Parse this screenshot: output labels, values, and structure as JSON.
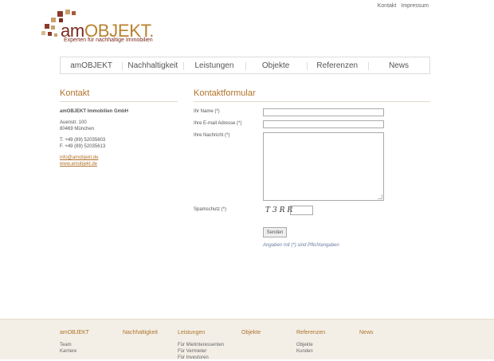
{
  "toplinks": [
    "Kontakt",
    "Impressum"
  ],
  "logo": {
    "am": "am",
    "objekt": "OBJEKT.",
    "tagline": "Experten für nachhaltige Immobilien"
  },
  "nav": [
    "amOBJEKT",
    "Nachhaltigkeit",
    "Leistungen",
    "Objekte",
    "Referenzen",
    "News"
  ],
  "kontakt": {
    "title": "Kontakt",
    "company": "amOBJEKT Immobilien GmbH",
    "street": "Auenstr. 100",
    "city": "80469 München",
    "phone": "T. +49 (89) 52035603",
    "fax": "F. +49 (89) 52035613",
    "email": "info@amobjekt.de",
    "web": "www.amobjekt.de"
  },
  "form": {
    "title": "Kontaktformular",
    "name_label": "Ihr Name (*)",
    "email_label": "Ihre E-mail Adresse (*)",
    "message_label": "Ihre Nachricht (*)",
    "spam_label": "Spamschutz (*)",
    "captcha": "T3RR",
    "send": "Senden",
    "note": "Angaben mit (*) sind Pflichtangaben"
  },
  "footer": [
    {
      "head": "amOBJEKT",
      "items": [
        "Team",
        "Karriere"
      ]
    },
    {
      "head": "Nachhaltigkeit",
      "items": []
    },
    {
      "head": "Leistungen",
      "items": [
        "Für Mietinteressenten",
        "Für Vermieter",
        "Für Investoren"
      ]
    },
    {
      "head": "Objekte",
      "items": []
    },
    {
      "head": "Referenzen",
      "items": [
        "Objekte",
        "Kunden"
      ]
    },
    {
      "head": "News",
      "items": []
    }
  ],
  "colors": {
    "accent": "#b0722a",
    "brand": "#7a2a1e"
  }
}
